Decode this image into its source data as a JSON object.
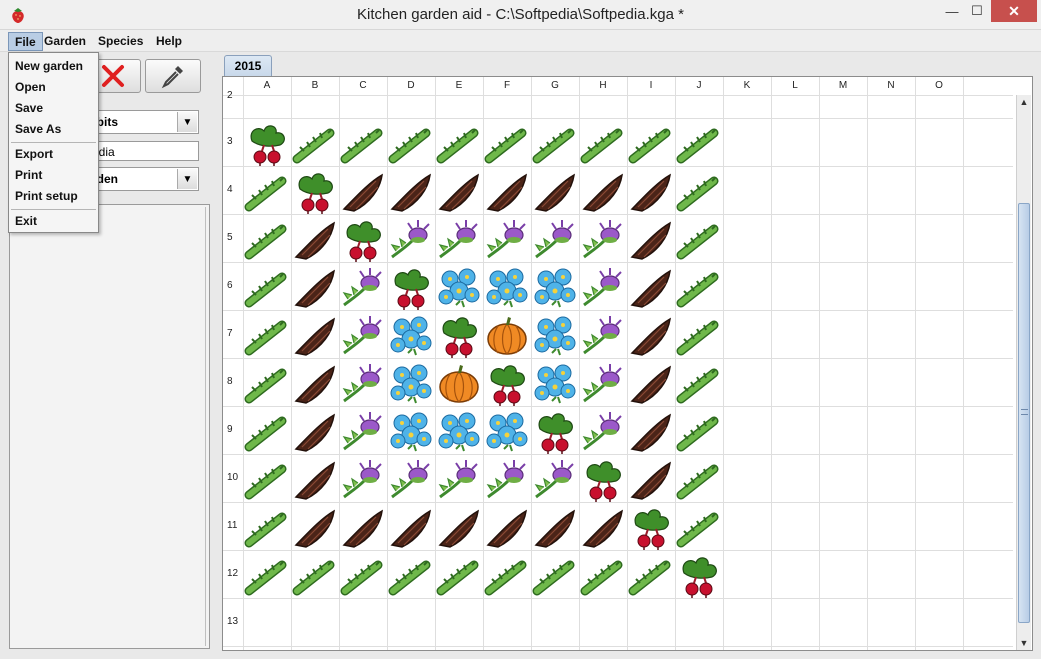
{
  "window": {
    "title": "Kitchen garden aid - C:\\Softpedia\\Softpedia.kga *",
    "minimize": "—",
    "maximize": "☐",
    "close": "✕"
  },
  "menubar": {
    "file": "File",
    "garden": "Garden",
    "species": "Species",
    "help": "Help"
  },
  "file_menu": {
    "items": [
      "New garden",
      "Open",
      "Save",
      "Save As",
      "Export",
      "Print",
      "Print setup",
      "Exit"
    ]
  },
  "left_panel": {
    "species_group_value": "rbits",
    "name_field_value": "edia",
    "garden_select_value": "rden",
    "combo_arrow": "▼"
  },
  "tab": {
    "label": "2015"
  },
  "grid": {
    "columns": [
      "A",
      "B",
      "C",
      "D",
      "E",
      "F",
      "G",
      "H",
      "I",
      "J",
      "K",
      "L",
      "M",
      "N",
      "O"
    ],
    "rows": [
      "2",
      "3",
      "4",
      "5",
      "6",
      "7",
      "8",
      "9",
      "10",
      "11",
      "12",
      "13"
    ],
    "plants": {
      "3": [
        "beet",
        "asparagus",
        "asparagus",
        "asparagus",
        "asparagus",
        "asparagus",
        "asparagus",
        "asparagus",
        "asparagus",
        "asparagus"
      ],
      "4": [
        "asparagus",
        "beet",
        "chicory",
        "chicory",
        "chicory",
        "chicory",
        "chicory",
        "chicory",
        "chicory",
        "asparagus"
      ],
      "5": [
        "asparagus",
        "chicory",
        "beet",
        "thistle",
        "thistle",
        "thistle",
        "thistle",
        "thistle",
        "chicory",
        "asparagus"
      ],
      "6": [
        "asparagus",
        "chicory",
        "thistle",
        "beet",
        "borage",
        "borage",
        "borage",
        "thistle",
        "chicory",
        "asparagus"
      ],
      "7": [
        "asparagus",
        "chicory",
        "thistle",
        "borage",
        "beet",
        "pumpkin",
        "borage",
        "thistle",
        "chicory",
        "asparagus"
      ],
      "8": [
        "asparagus",
        "chicory",
        "thistle",
        "borage",
        "pumpkin",
        "beet",
        "borage",
        "thistle",
        "chicory",
        "asparagus"
      ],
      "9": [
        "asparagus",
        "chicory",
        "thistle",
        "borage",
        "borage",
        "borage",
        "beet",
        "thistle",
        "chicory",
        "asparagus"
      ],
      "10": [
        "asparagus",
        "chicory",
        "thistle",
        "thistle",
        "thistle",
        "thistle",
        "thistle",
        "beet",
        "chicory",
        "asparagus"
      ],
      "11": [
        "asparagus",
        "chicory",
        "chicory",
        "chicory",
        "chicory",
        "chicory",
        "chicory",
        "chicory",
        "beet",
        "asparagus"
      ],
      "12": [
        "asparagus",
        "asparagus",
        "asparagus",
        "asparagus",
        "asparagus",
        "asparagus",
        "asparagus",
        "asparagus",
        "asparagus",
        "beet"
      ]
    }
  },
  "colors": {
    "menu_highlight": "#b9cde4",
    "close_button": "#c7504d",
    "grid_line": "#dedede"
  }
}
